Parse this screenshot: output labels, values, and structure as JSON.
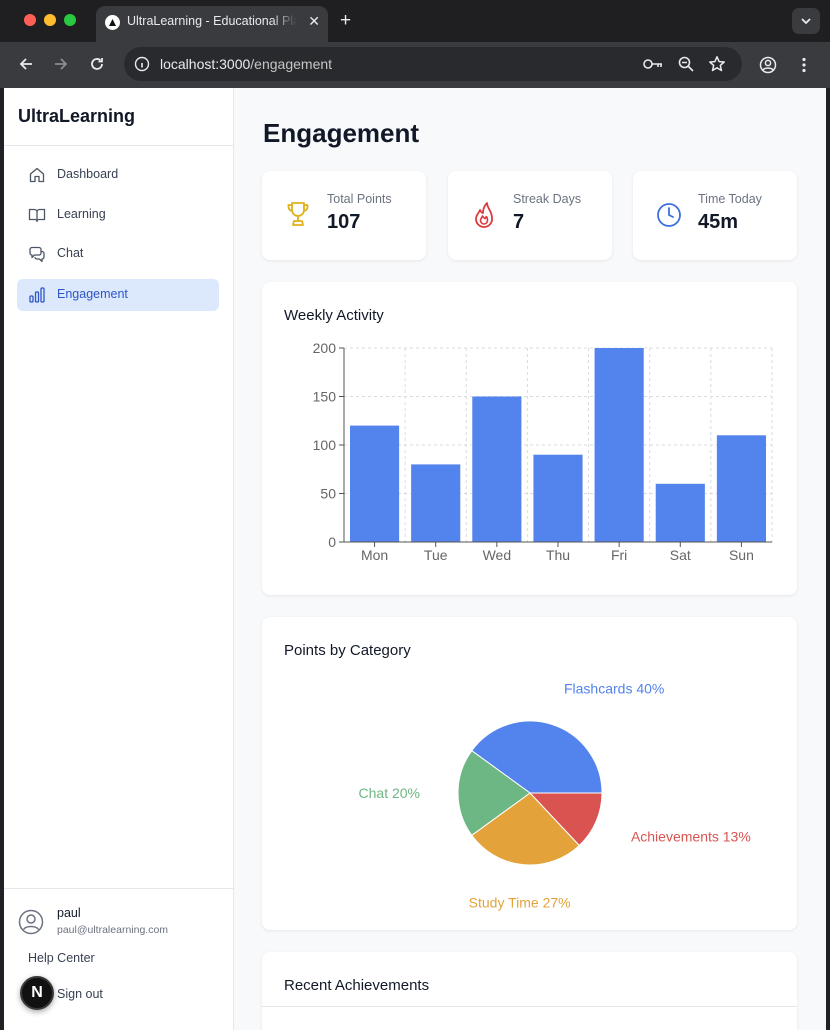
{
  "browser": {
    "tab_title": "UltraLearning - Educational Platform",
    "url_host": "localhost:3000",
    "url_path": "/engagement"
  },
  "sidebar": {
    "brand": "UltraLearning",
    "items": [
      {
        "label": "Dashboard",
        "icon": "home-icon",
        "active": false
      },
      {
        "label": "Learning",
        "icon": "book-icon",
        "active": false
      },
      {
        "label": "Chat",
        "icon": "chat-icon",
        "active": false
      },
      {
        "label": "Engagement",
        "icon": "bar-chart-icon",
        "active": true
      }
    ],
    "user": {
      "name": "paul",
      "email": "paul@ultralearning.com"
    },
    "help": "Help Center",
    "signout": "Sign out",
    "next_badge": "N"
  },
  "page": {
    "title": "Engagement"
  },
  "stats": [
    {
      "label": "Total Points",
      "value": "107",
      "icon": "trophy-icon",
      "color": "#e0b11a"
    },
    {
      "label": "Streak Days",
      "value": "7",
      "icon": "flame-icon",
      "color": "#dc3b3b"
    },
    {
      "label": "Time Today",
      "value": "45m",
      "icon": "clock-icon",
      "color": "#3b6fe0"
    }
  ],
  "weekly": {
    "title": "Weekly Activity"
  },
  "category": {
    "title": "Points by Category"
  },
  "achievements": {
    "title": "Recent Achievements"
  },
  "chart_data": [
    {
      "type": "bar",
      "title": "Weekly Activity",
      "categories": [
        "Mon",
        "Tue",
        "Wed",
        "Thu",
        "Fri",
        "Sat",
        "Sun"
      ],
      "values": [
        120,
        80,
        150,
        90,
        200,
        60,
        110
      ],
      "ylim": [
        0,
        200
      ],
      "yticks": [
        0,
        50,
        100,
        150,
        200
      ],
      "grid": true,
      "color": "#5383ec"
    },
    {
      "type": "pie",
      "title": "Points by Category",
      "slices": [
        {
          "label": "Flashcards 40%",
          "value": 40,
          "color": "#5383ec"
        },
        {
          "label": "Achievements 13%",
          "value": 13,
          "color": "#d95450"
        },
        {
          "label": "Study Time 27%",
          "value": 27,
          "color": "#e3a33a"
        },
        {
          "label": "Chat 20%",
          "value": 20,
          "color": "#6db784"
        }
      ]
    }
  ]
}
